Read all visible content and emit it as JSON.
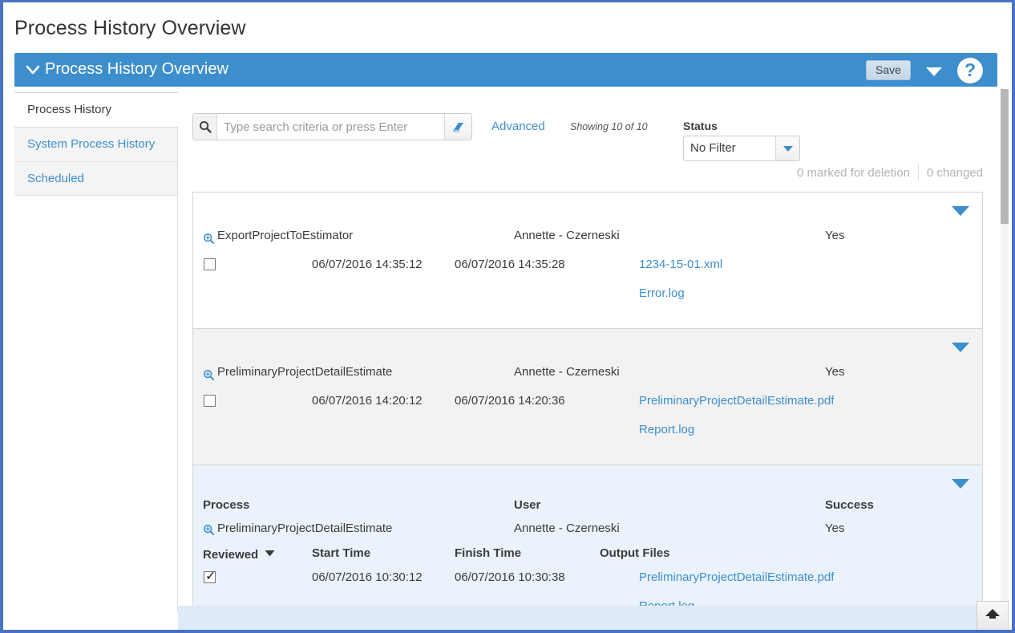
{
  "page": {
    "title": "Process History Overview"
  },
  "panel": {
    "title": "Process History Overview",
    "collapse_icon": "chevron-down-icon",
    "save_label": "Save",
    "menu_icon": "caret-down-icon",
    "help_label": "?",
    "accent_color": "#3d8ecd"
  },
  "sidebar": {
    "items": [
      {
        "label": "Process History",
        "active": true
      },
      {
        "label": "System Process History",
        "active": false
      },
      {
        "label": "Scheduled",
        "active": false
      }
    ]
  },
  "toolbar": {
    "search": {
      "icon": "search-icon",
      "value": "",
      "placeholder": "Type search criteria or press Enter",
      "clear_icon": "eraser-icon"
    },
    "advanced_label": "Advanced",
    "showing_text": "Showing 10 of 10",
    "status": {
      "label": "Status",
      "value": "No Filter",
      "options": [
        "No Filter"
      ]
    }
  },
  "meta": {
    "marked_for_deletion": "0 marked for deletion",
    "changed": "0 changed"
  },
  "columns": {
    "process": "Process",
    "user": "User",
    "success": "Success",
    "reviewed": "Reviewed",
    "start_time": "Start Time",
    "finish_time": "Finish Time",
    "output_files": "Output Files"
  },
  "records": [
    {
      "process": "ExportProjectToEstimator",
      "user": "Annette - Czerneski",
      "success": "Yes",
      "reviewed": false,
      "start_time": "06/07/2016 14:35:12",
      "finish_time": "06/07/2016 14:35:28",
      "output_files": [
        "1234-15-01.xml",
        "Error.log"
      ],
      "show_headers": false,
      "background": "white"
    },
    {
      "process": "PreliminaryProjectDetailEstimate",
      "user": "Annette - Czerneski",
      "success": "Yes",
      "reviewed": false,
      "start_time": "06/07/2016 14:20:12",
      "finish_time": "06/07/2016 14:20:36",
      "output_files": [
        "PreliminaryProjectDetailEstimate.pdf",
        "Report.log"
      ],
      "show_headers": false,
      "background": "gray"
    },
    {
      "process": "PreliminaryProjectDetailEstimate",
      "user": "Annette - Czerneski",
      "success": "Yes",
      "reviewed": true,
      "start_time": "06/07/2016 10:30:12",
      "finish_time": "06/07/2016 10:30:38",
      "output_files": [
        "PreliminaryProjectDetailEstimate.pdf",
        "Report.log"
      ],
      "show_headers": true,
      "background": "blue"
    }
  ],
  "footer": {
    "scroll_top_icon": "arrow-up-icon"
  }
}
